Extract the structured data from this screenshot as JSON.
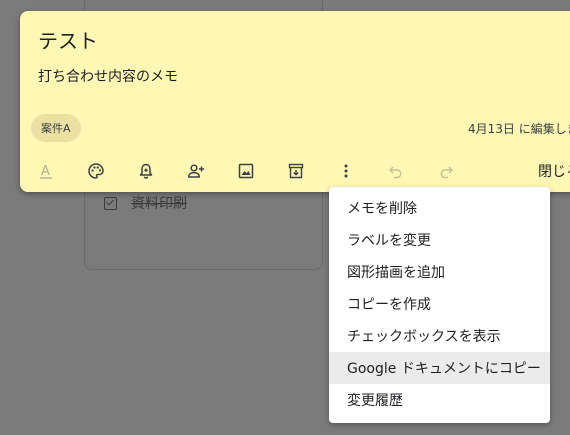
{
  "background_note": {
    "item_text": "資料印刷",
    "checked": true
  },
  "note": {
    "title": "テスト",
    "body": "打ち合わせ内容のメモ",
    "label": "案件A",
    "edited_text": "4月13日 に編集しま",
    "close_label": "閉じる",
    "background_color": "#fff8b4"
  },
  "toolbar": {
    "icons": [
      "text-format-icon",
      "palette-icon",
      "reminder-bell-icon",
      "collaborator-icon",
      "image-icon",
      "archive-icon",
      "more-vert-icon",
      "undo-icon",
      "redo-icon"
    ]
  },
  "menu": {
    "items": [
      "メモを削除",
      "ラベルを変更",
      "図形描画を追加",
      "コピーを作成",
      "チェックボックスを表示",
      "Google ドキュメントにコピー",
      "変更履歴"
    ],
    "highlighted_index": 5
  },
  "colors": {
    "overlay": "#7b7b7b",
    "note": "#fff8b4",
    "chip": "#eae1a2",
    "menu_hover": "#ebebeb"
  }
}
